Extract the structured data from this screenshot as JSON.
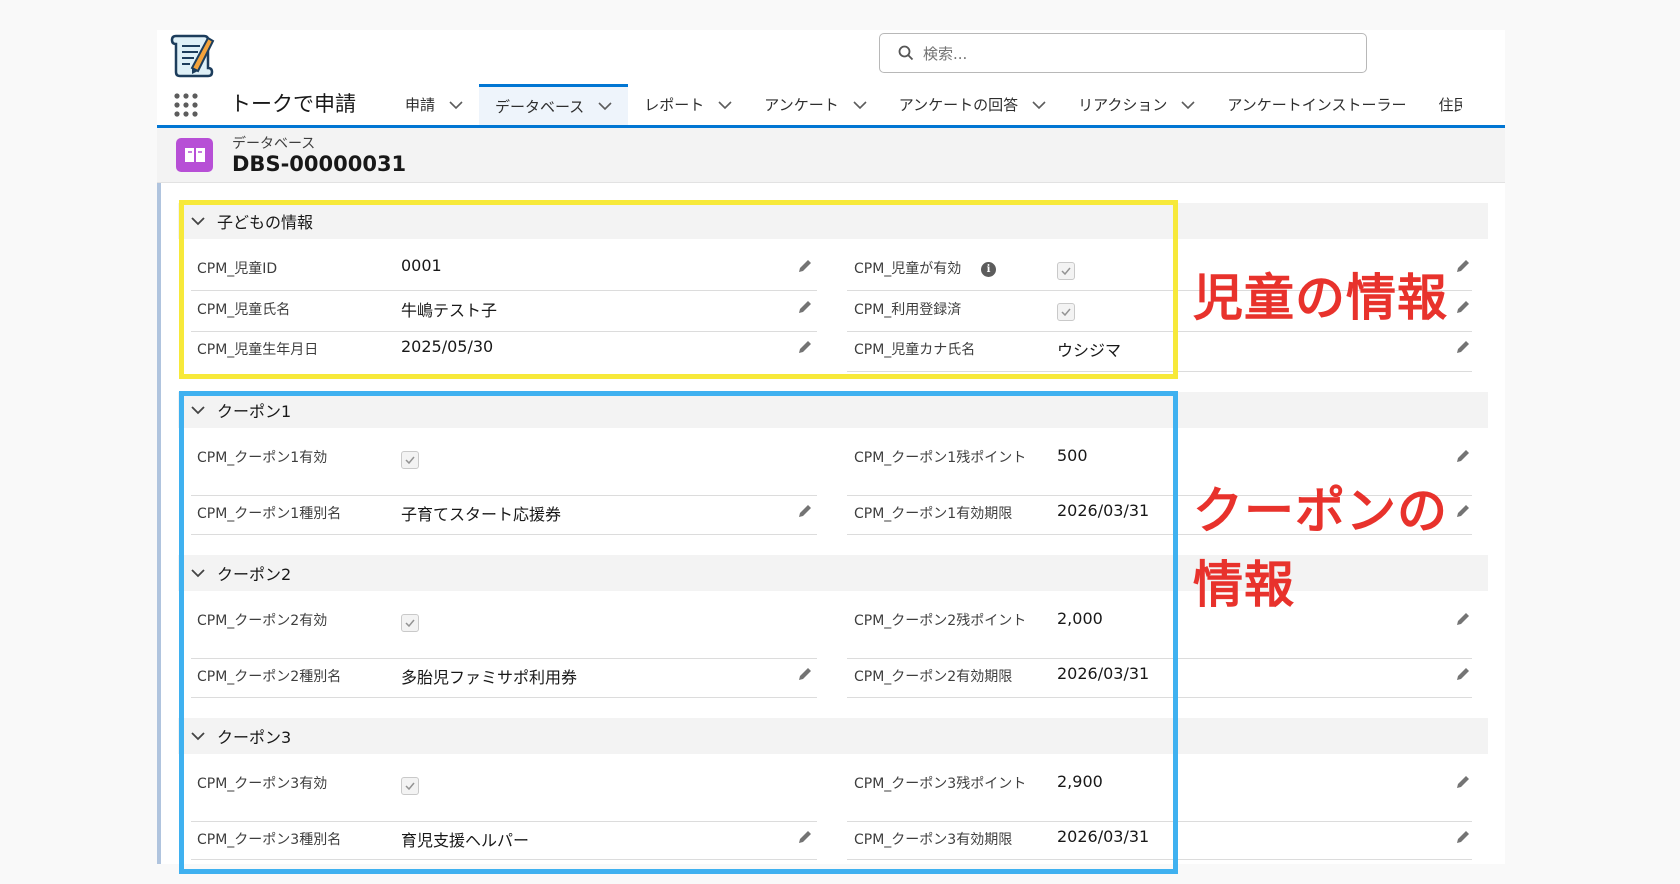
{
  "search": {
    "placeholder": "検索..."
  },
  "nav": {
    "app_name": "トークで申請",
    "tabs": [
      {
        "label": "申請"
      },
      {
        "label": "データベース",
        "active": true
      },
      {
        "label": "レポート"
      },
      {
        "label": "アンケート"
      },
      {
        "label": "アンケートの回答"
      },
      {
        "label": "リアクション"
      },
      {
        "label": "アンケートインストーラー"
      },
      {
        "label": "住民"
      }
    ]
  },
  "record": {
    "object_label": "データベース",
    "name": "DBS-00000031"
  },
  "sections": {
    "child": {
      "title": "子どもの情報",
      "f1": {
        "label": "CPM_児童ID",
        "value": "0001"
      },
      "f2": {
        "label": "CPM_児童氏名",
        "value": "牛嶋テスト子"
      },
      "f3": {
        "label": "CPM_児童生年月日",
        "value": "2025/05/30"
      },
      "f4": {
        "label": "CPM_児童が有効",
        "checked": true
      },
      "f5": {
        "label": "CPM_利用登録済",
        "checked": true
      },
      "f6": {
        "label": "CPM_児童カナ氏名",
        "value": "ウシジマ"
      }
    },
    "coupon1": {
      "title": "クーポン1",
      "f1": {
        "label": "CPM_クーポン1有効",
        "checked": true
      },
      "f2": {
        "label": "CPM_クーポン1種別名",
        "value": "子育てスタート応援券"
      },
      "f3": {
        "label": "CPM_クーポン1残ポイント",
        "value": "500"
      },
      "f4": {
        "label": "CPM_クーポン1有効期限",
        "value": "2026/03/31"
      }
    },
    "coupon2": {
      "title": "クーポン2",
      "f1": {
        "label": "CPM_クーポン2有効",
        "checked": true
      },
      "f2": {
        "label": "CPM_クーポン2種別名",
        "value": "多胎児ファミサポ利用券"
      },
      "f3": {
        "label": "CPM_クーポン2残ポイント",
        "value": "2,000"
      },
      "f4": {
        "label": "CPM_クーポン2有効期限",
        "value": "2026/03/31"
      }
    },
    "coupon3": {
      "title": "クーポン3",
      "f1": {
        "label": "CPM_クーポン3有効",
        "checked": true
      },
      "f2": {
        "label": "CPM_クーポン3種別名",
        "value": "育児支援ヘルパー"
      },
      "f3": {
        "label": "CPM_クーポン3残ポイント",
        "value": "2,900"
      },
      "f4": {
        "label": "CPM_クーポン3有効期限",
        "value": "2026/03/31"
      }
    }
  },
  "annotations": {
    "child_note": "児童の情報",
    "coupon_note_line1": "クーポンの",
    "coupon_note_line2": "情報",
    "colors": {
      "yellow": "#f7e93a",
      "blue": "#3fb1f0",
      "red": "#e8322c"
    }
  },
  "colors": {
    "brand_blue": "#0176d3",
    "record_icon": "#b74fd6"
  }
}
